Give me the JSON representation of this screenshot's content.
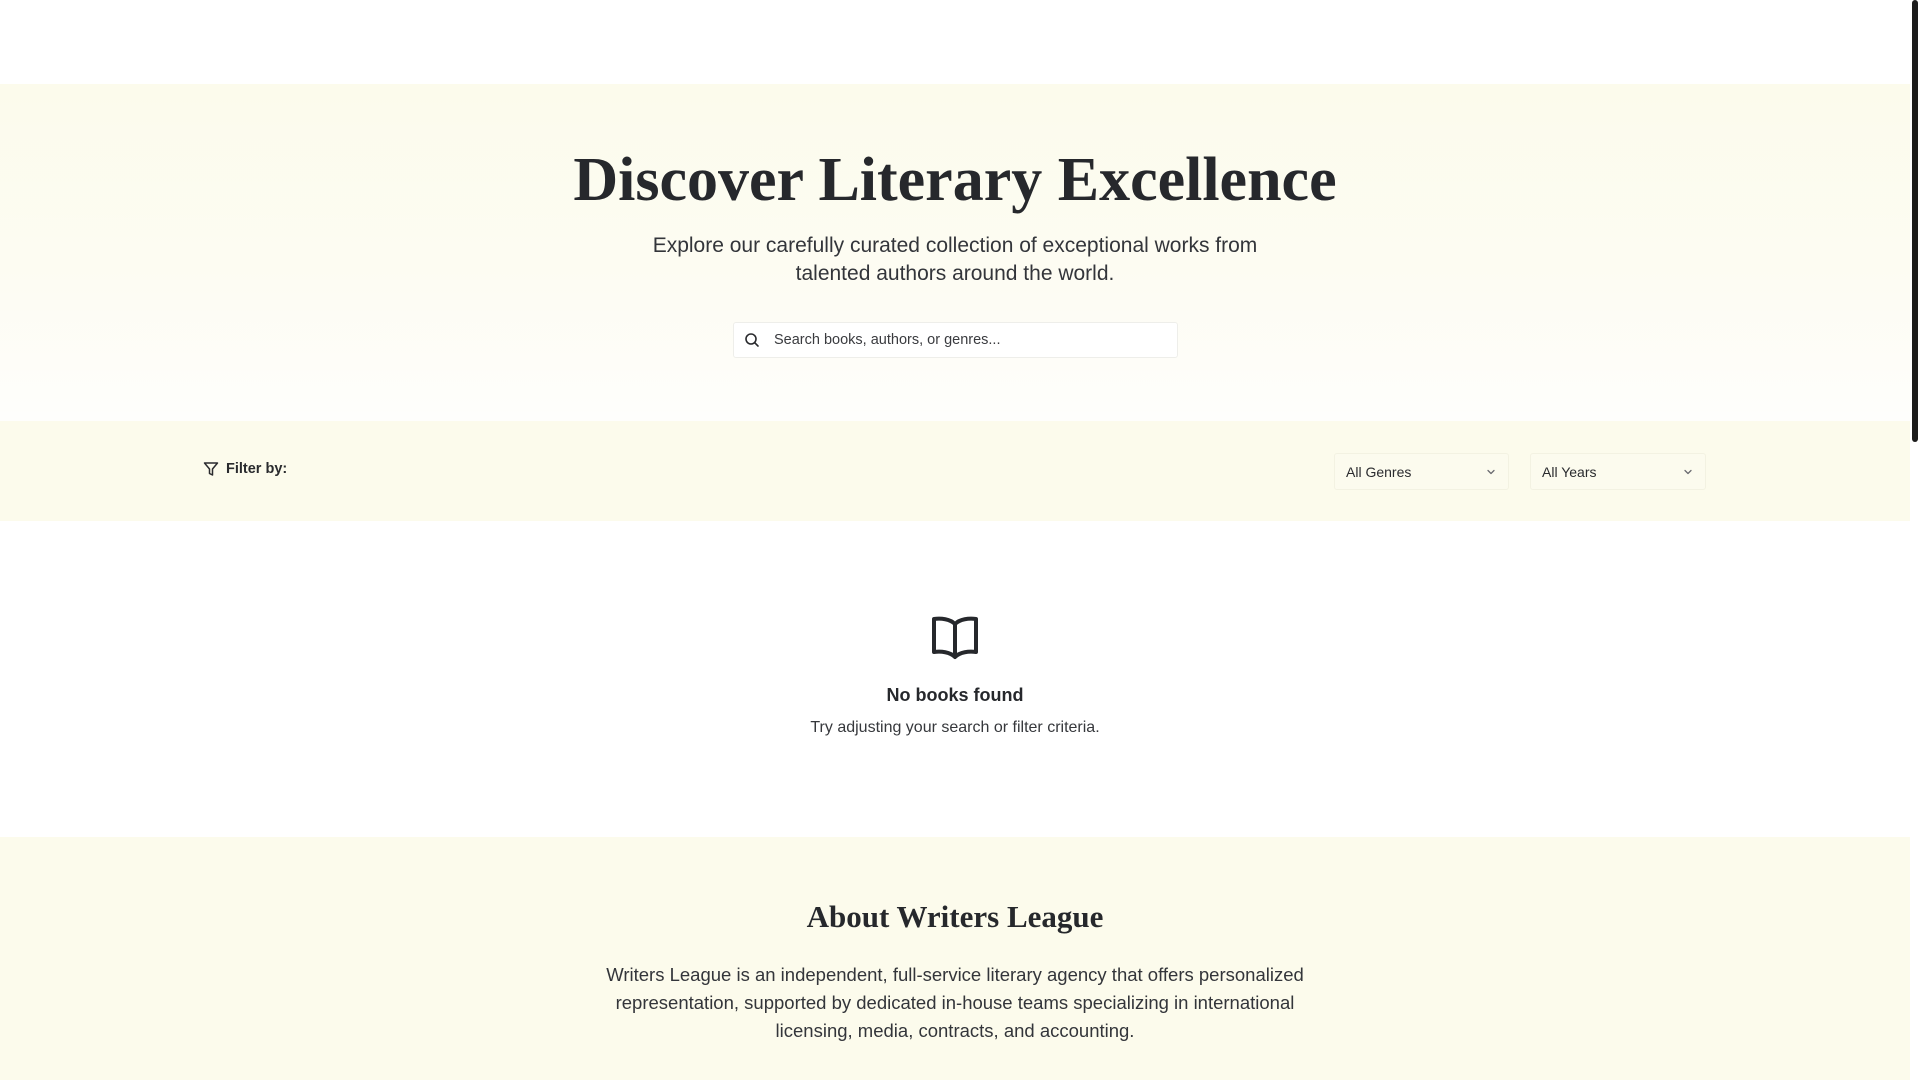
{
  "hero": {
    "title": "Discover Literary Excellence",
    "subtitle": "Explore our carefully curated collection of exceptional works from talented authors around the world.",
    "search_placeholder": "Search books, authors, or genres..."
  },
  "filters": {
    "label": "Filter by:",
    "genre_selected": "All Genres",
    "year_selected": "All Years"
  },
  "empty_state": {
    "icon": "open-book-icon",
    "title": "No books found",
    "message": "Try adjusting your search or filter criteria."
  },
  "about": {
    "title": "About Writers League",
    "text": "Writers League is an independent, full-service literary agency that offers personalized representation, supported by dedicated in-house teams specializing in international licensing, media, contracts, and accounting."
  },
  "colors": {
    "cream_background": "#fcfbec",
    "text_dark": "#26282c"
  }
}
